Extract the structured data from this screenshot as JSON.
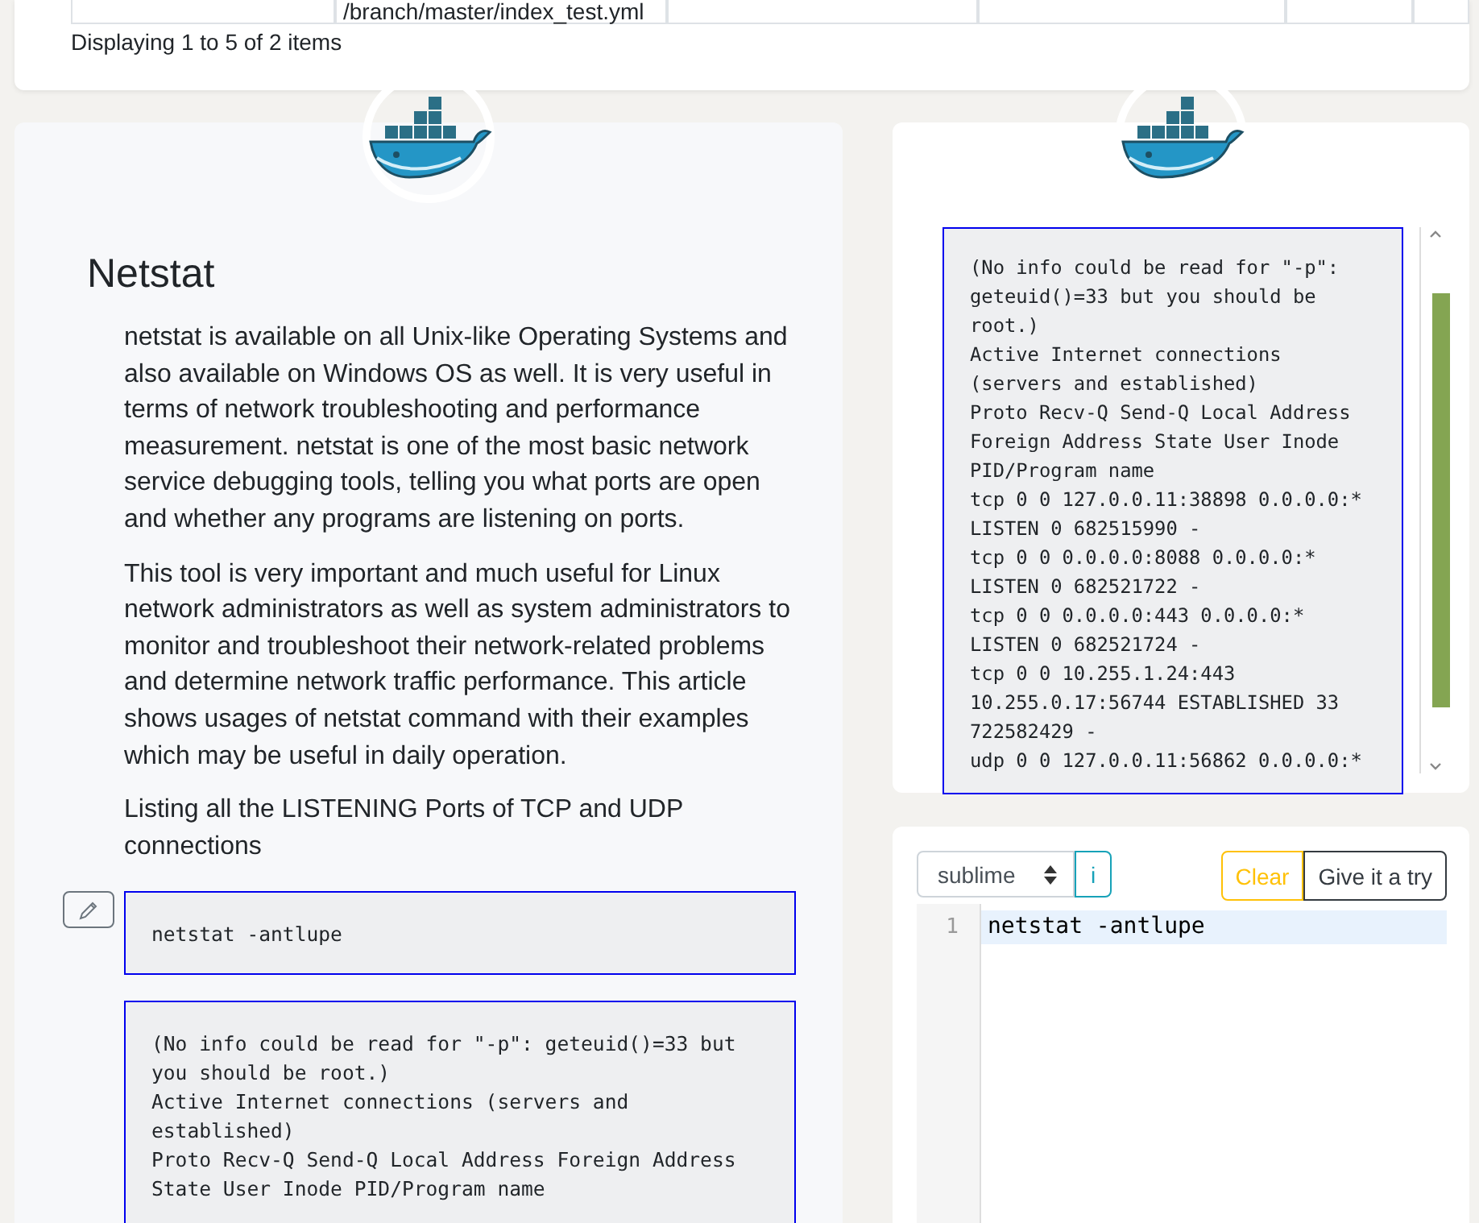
{
  "top_table": {
    "cells": [
      "",
      "/branch/master/index_test.yml",
      "",
      "",
      "",
      ""
    ],
    "footer": "Displaying 1 to 5 of 2 items"
  },
  "article": {
    "title": "Netstat",
    "paragraphs": [
      "netstat is available on all Unix-like Operating Systems and also available on Windows OS as well. It is very useful in terms of network troubleshooting and performance measurement. netstat is one of the most basic network service debugging tools, telling you what ports are open and whether any programs are listening on ports.",
      "This tool is very important and much useful for Linux network administrators as well as system administrators to monitor and troubleshoot their network-related problems and determine network traffic performance. This article shows usages of netstat command with their examples which may be useful in daily operation.",
      "Listing all the LISTENING Ports of TCP and UDP connections"
    ],
    "command": "netstat -antlupe",
    "output": [
      "(No info could be read for \"-p\": geteuid()=33 but you should be root.)",
      "Active Internet connections (servers and established)",
      "Proto Recv-Q Send-Q Local Address Foreign Address State User Inode PID/Program name"
    ]
  },
  "side_output": {
    "lines": [
      "(No info could be read for \"-p\": geteuid()=33 but you should be root.)",
      "Active Internet connections (servers and established)",
      "Proto Recv-Q Send-Q Local Address Foreign Address State User Inode PID/Program name",
      "tcp 0 0 127.0.0.11:38898 0.0.0.0:* LISTEN 0 682515990 -",
      "tcp 0 0 0.0.0.0:8088 0.0.0.0:* LISTEN 0 682521722 -",
      "tcp 0 0 0.0.0.0:443 0.0.0.0:* LISTEN 0 682521724 -",
      "tcp 0 0 10.255.1.24:443 10.255.0.17:56744 ESTABLISHED 33 722582429 -",
      "udp 0 0 127.0.0.11:56862 0.0.0.0:*"
    ]
  },
  "editor": {
    "theme": "sublime",
    "info_button": "i",
    "clear_button": "Clear",
    "run_button": "Give it a try",
    "lines": [
      {
        "number": "1",
        "code": "netstat -antlupe",
        "selected": true
      }
    ]
  }
}
